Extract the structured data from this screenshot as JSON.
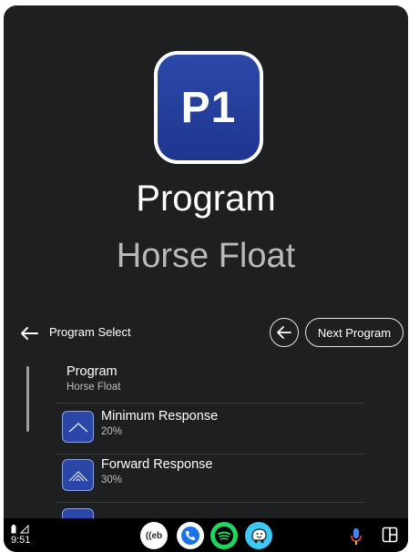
{
  "hero": {
    "badge_label": "P1",
    "title": "Program",
    "subtitle": "Horse Float"
  },
  "header": {
    "title": "Program Select",
    "next_button_label": "Next Program"
  },
  "list": {
    "items": [
      {
        "title": "Program",
        "subtitle": "Horse Float"
      },
      {
        "title": "Minimum Response",
        "subtitle": "20%",
        "icon": "minimum-response-icon"
      },
      {
        "title": "Forward Response",
        "subtitle": "30%",
        "icon": "forward-response-icon"
      },
      {
        "title": "",
        "subtitle": "",
        "icon": "response-icon"
      }
    ]
  },
  "taskbar": {
    "time": "9:51",
    "apps": [
      {
        "name": "web-radio-app",
        "label": "((eb"
      },
      {
        "name": "phone-app"
      },
      {
        "name": "spotify-app"
      },
      {
        "name": "waze-app"
      }
    ]
  },
  "colors": {
    "background": "#1e1f21",
    "accent_blue": "#2a46a8",
    "spotify_green": "#1ed760",
    "waze_blue": "#3fc8f6"
  }
}
